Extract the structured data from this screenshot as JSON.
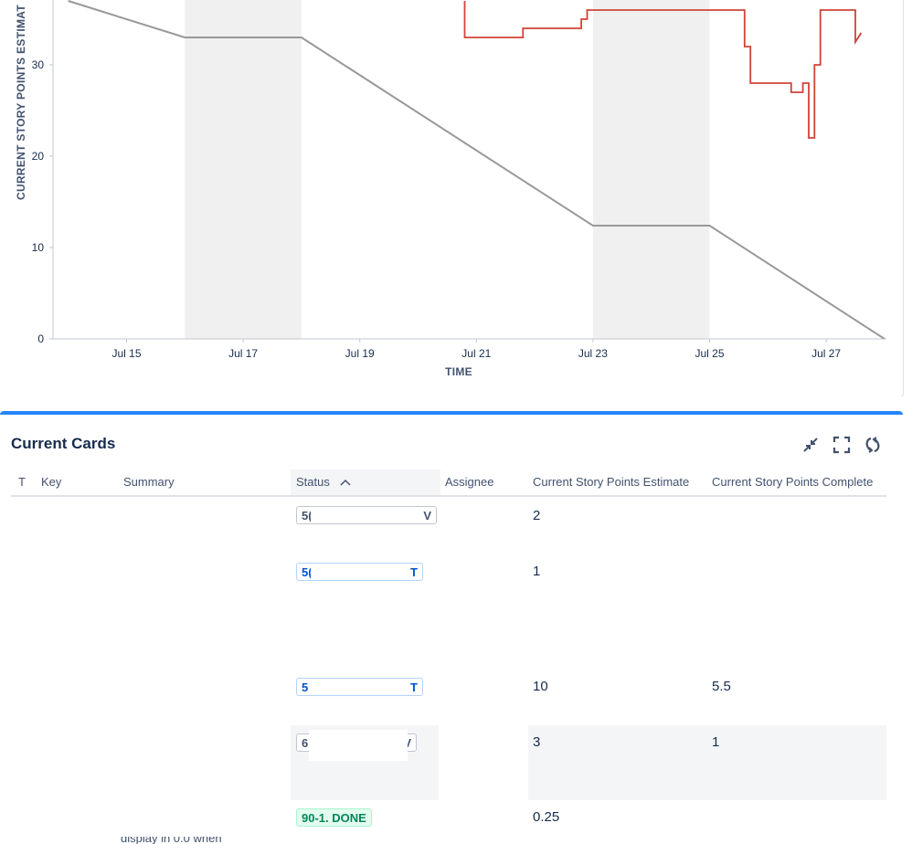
{
  "chart_data": {
    "type": "line",
    "ylabel": "CURRENT STORY POINTS ESTIMAT",
    "xlabel": "TIME",
    "y_ticks": [
      "0",
      "10",
      "20",
      "30"
    ],
    "x_ticks": [
      "Jul 15",
      "Jul 17",
      "Jul 19",
      "Jul 21",
      "Jul 23",
      "Jul 25",
      "Jul 27"
    ],
    "ylim": [
      0,
      37
    ],
    "non_working_periods": [
      [
        "Jul 16",
        "Jul 18"
      ],
      [
        "Jul 23",
        "Jul 25"
      ]
    ],
    "series": [
      {
        "color": "#999999",
        "points": [
          [
            "Jul 14",
            37
          ],
          [
            "Jul 16",
            33
          ],
          [
            "Jul 18",
            33
          ],
          [
            "Jul 23",
            12.4
          ],
          [
            "Jul 25",
            12.4
          ],
          [
            "Jul 28",
            0
          ]
        ]
      },
      {
        "color": "#d04437",
        "step": true,
        "points": [
          [
            "Jul 20.8",
            37
          ],
          [
            "Jul 20.8",
            33
          ],
          [
            "Jul 21.8",
            33
          ],
          [
            "Jul 21.8",
            34
          ],
          [
            "Jul 22.8",
            34
          ],
          [
            "Jul 22.8",
            35
          ],
          [
            "Jul 22.9",
            35
          ],
          [
            "Jul 22.9",
            36
          ],
          [
            "Jul 25.6",
            36
          ],
          [
            "Jul 25.6",
            32
          ],
          [
            "Jul 25.7",
            32
          ],
          [
            "Jul 25.7",
            28
          ],
          [
            "Jul 26.4",
            28
          ],
          [
            "Jul 26.4",
            27
          ],
          [
            "Jul 26.6",
            27
          ],
          [
            "Jul 26.6",
            28
          ],
          [
            "Jul 26.7",
            28
          ],
          [
            "Jul 26.7",
            22
          ],
          [
            "Jul 26.8",
            22
          ],
          [
            "Jul 26.8",
            30
          ],
          [
            "Jul 26.9",
            30
          ],
          [
            "Jul 26.9",
            36
          ],
          [
            "Jul 27.5",
            36
          ],
          [
            "Jul 27.5",
            32.5
          ],
          [
            "Jul 27.6",
            33.5
          ]
        ]
      }
    ]
  },
  "cards": {
    "title": "Current Cards",
    "columns": {
      "t": "T",
      "key": "Key",
      "summary": "Summary",
      "status": "Status",
      "assignee": "Assignee",
      "estimate": "Current Story Points Estimate",
      "complete": "Current Story Points Complete"
    },
    "rows": [
      {
        "status_prefix": "5(",
        "status_suffix": "V",
        "estimate": "2",
        "complete": ""
      },
      {
        "status_prefix": "5(",
        "status_suffix": "T",
        "estimate": "1",
        "complete": ""
      },
      {
        "status_prefix": "5",
        "status_suffix": "T",
        "estimate": "10",
        "complete": "5.5"
      },
      {
        "status_prefix": "6",
        "status_suffix": "V",
        "estimate": "3",
        "complete": "1"
      },
      {
        "status_full": "90-1. DONE",
        "estimate": "0.25",
        "complete": ""
      }
    ],
    "summary_fragment": "display in 0.0 when"
  }
}
